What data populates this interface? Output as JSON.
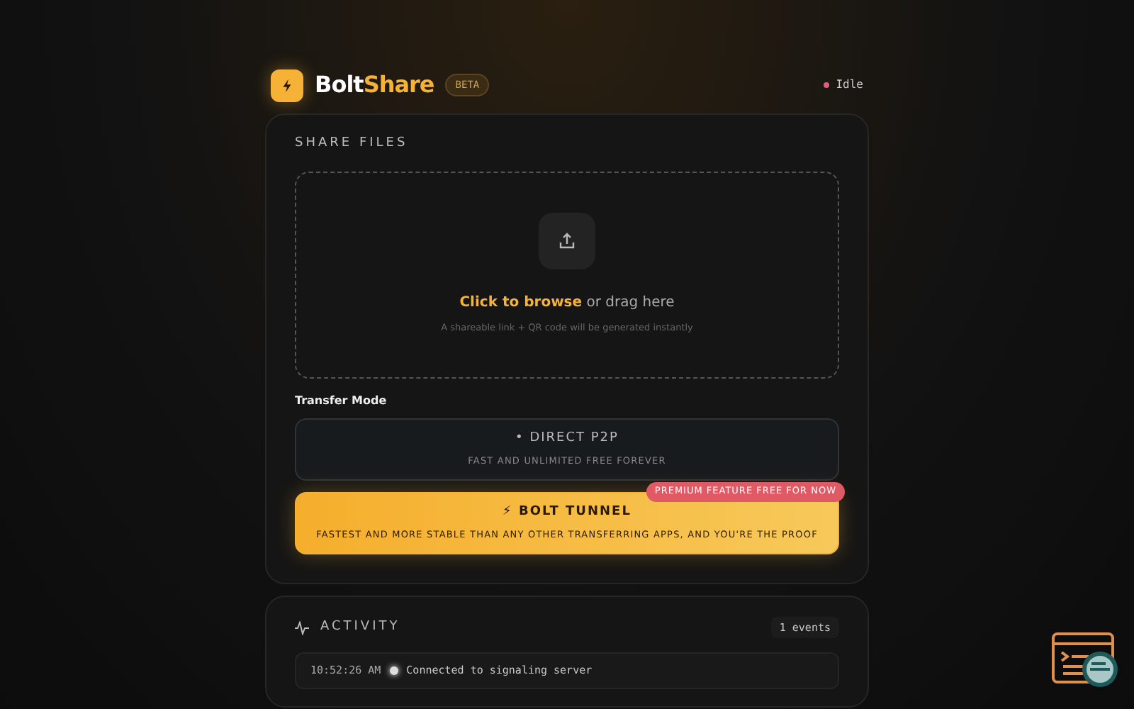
{
  "brand": {
    "name_part_1": "Bolt",
    "name_part_2": "Share",
    "badge": "BETA"
  },
  "status": {
    "label": "Idle",
    "color": "#e0607a"
  },
  "share": {
    "title": "SHARE FILES",
    "dropzone": {
      "text": "**Click to browse** or drag here",
      "hint": "A shareable link + QR code will be generated instantly"
    },
    "mode_label": "Transfer Mode",
    "modes": [
      {
        "title": "• DIRECT P2P",
        "subtitle": "FAST AND UNLIMITED FREE FOREVER",
        "selected": false
      },
      {
        "title": "⚡ BOLT TUNNEL",
        "subtitle": "FASTEST AND MORE STABLE THAN ANY OTHER TRANSFERRING APPS, AND YOU'RE THE PROOF",
        "selected": true,
        "badge": "PREMIUM FEATURE FREE FOR NOW"
      }
    ]
  },
  "activity": {
    "title": "ACTIVITY",
    "count": "1 events",
    "events": [
      {
        "time": "10:52:26 AM",
        "text": "Connected to signaling server"
      }
    ]
  }
}
